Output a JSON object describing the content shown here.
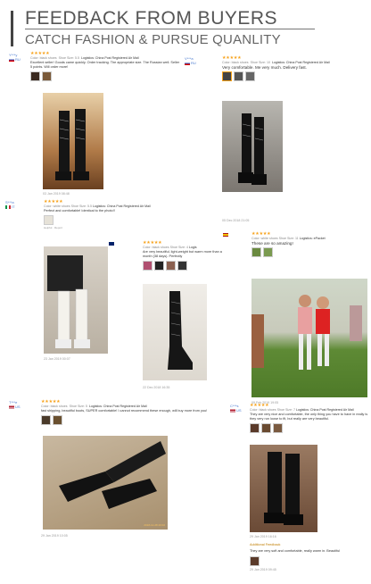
{
  "header": {
    "title": "FEEDBACK FROM BUYERS",
    "subtitle": "CATCH FASHION & PURSUE QUANLITY"
  },
  "colors": {
    "stars": "#f7a21b",
    "username": "#4a7bd0",
    "muted": "#888"
  },
  "reviews": [
    {
      "user": "Y***y",
      "country": "RU",
      "stars": "★★★★★",
      "color": "Color: black shoes",
      "size": "Shoe Size: 5.5",
      "logistics": "Logistics: China Post Registered Air Mail",
      "text": "Excellent seller! Goods came quickly. Order tracking. The appropriate size. The Russian well. Seller 5 points. Will order more!",
      "date": "03 Jan 2019 08:48"
    },
    {
      "user": "V***a",
      "country": "RU",
      "stars": "★★★★★",
      "color": "Color: black shoes",
      "size": "Shoe Size: 10",
      "logistics": "Logistics: China Post Registered Air Mail",
      "text": "Very comfortable. Me very much. Delivery fast.",
      "date": "05 Dec 2018 21:05"
    },
    {
      "user": "S***a",
      "country": "IT",
      "stars": "★★★★★",
      "color": "Color: white shoes",
      "size": "Shoe Size: 5.5",
      "logistics": "Logistics: China Post Registered Air Mail",
      "text": "Perfect and comfortable! Identical to the photo!!",
      "date": "23 Jan 2019 00:07"
    },
    {
      "user": "A***r",
      "country": "AU",
      "stars": "★★★★★",
      "color": "Color: black shoes",
      "size": "Shoe Size: 4",
      "logistics": "Logis",
      "text": "Are very beautiful, light-weight but warm more than a month (38 days). Perfectly",
      "date": "22 Dec 2018 16:35"
    },
    {
      "user": "E***a",
      "country": "ES",
      "stars": "★★★★★",
      "color": "Color: white shoes",
      "size": "Shoe Size: 11",
      "logistics": "Logistics: ePacket",
      "text": "These are so amazing!",
      "date": "09 Feb 2019 19:05"
    },
    {
      "user": "T***e",
      "country": "US",
      "stars": "★★★★★",
      "color": "Color: black shoes",
      "size": "Shoe Size: 5",
      "logistics": "Logistics: China Post Registered Air Mail",
      "text": "fast shipping, beautiful boots, SUPER comfortable! I cannot recommend these enough, will buy more from you!",
      "date": "29 Jan 2019 10:05",
      "photo_stamp": "2018-12-28 20:02"
    },
    {
      "user": "C***s",
      "country": "US",
      "stars": "★★★★★",
      "color": "Color: black shoes",
      "size": "Shoe Size: 7",
      "logistics": "Logistics: China Post Registered Air Mail",
      "text": "They are very nice and comfortable, the only thing you have to have in really is they very run loose to fit, but really are very beautiful.",
      "date": "29 Jan 2019 16:16",
      "additional_label": "Additional Feedback",
      "additional_text": "They are very soft and comfortable, really warm in. Beautiful",
      "additional_date": "29 Jan 2019 09:45"
    }
  ],
  "helpful": "Helpful",
  "report": "Report"
}
